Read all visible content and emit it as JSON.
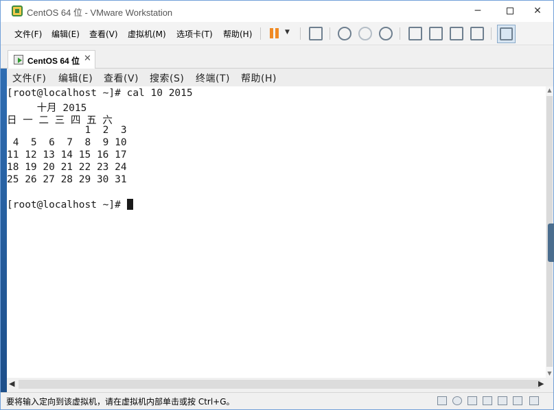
{
  "window": {
    "title": "CentOS 64 位 - VMware Workstation"
  },
  "controls": {
    "minimize": "─",
    "close": "✕"
  },
  "menubar": {
    "items": [
      "文件(F)",
      "编辑(E)",
      "查看(V)",
      "虚拟机(M)",
      "选项卡(T)",
      "帮助(H)"
    ]
  },
  "toolbar": {
    "icons": [
      "pause-icon",
      "send-keys-icon",
      "snapshot-icon",
      "revert-snapshot-icon",
      "snapshot-manager-icon",
      "library-icon",
      "console-view-icon",
      "fullscreen-icon",
      "unity-icon",
      "thumbnail-icon"
    ]
  },
  "tabs": [
    {
      "label": "CentOS 64 位",
      "close": "✕"
    }
  ],
  "guest": {
    "menubar": [
      "文件(F)",
      "编辑(E)",
      "查看(V)",
      "搜索(S)",
      "终端(T)",
      "帮助(H)"
    ],
    "terminal_lines": [
      "[root@localhost ~]# cal 10 2015",
      "     十月 2015",
      "日 一 二 三 四 五 六",
      "             1  2  3",
      " 4  5  6  7  8  9 10",
      "11 12 13 14 15 16 17",
      "18 19 20 21 22 23 24",
      "25 26 27 28 29 30 31",
      "",
      "[root@localhost ~]# "
    ]
  },
  "scroll": {
    "left": "◀",
    "right": "▶",
    "up": "▲",
    "down": "▼"
  },
  "statusbar": {
    "text": "要将输入定向到该虚拟机，请在虚拟机内部单击或按 Ctrl+G。"
  },
  "colors": {
    "accent": "#f08a24",
    "titlebar": "#ffffff",
    "terminal_bg": "#ffffff"
  }
}
